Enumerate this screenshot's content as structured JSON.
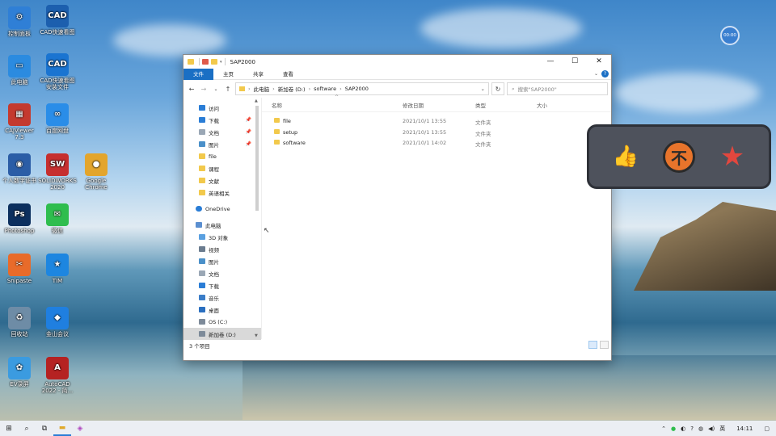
{
  "desktop": {
    "icons": [
      {
        "label": "控制面板",
        "glyph": "⚙",
        "color": "#2f7fd6"
      },
      {
        "label": "CAD快速看图",
        "glyph": "CAD",
        "color": "#1c5fae"
      },
      {
        "label": "此电脑",
        "glyph": "▭",
        "color": "#2b8be0"
      },
      {
        "label": "CAD快速看图 安装文件",
        "glyph": "CAD",
        "color": "#1a74d1"
      },
      {
        "label": "CAJViewer 7.3",
        "glyph": "▦",
        "color": "#c43a2f"
      },
      {
        "label": "百度网盘",
        "glyph": "∞",
        "color": "#2a8de8"
      },
      {
        "label": "个人数字证书",
        "glyph": "◉",
        "color": "#2b5da6"
      },
      {
        "label": "SOLIDWORKS 2020",
        "glyph": "SW",
        "color": "#c62f2f"
      },
      {
        "label": "Google Chrome",
        "glyph": "●",
        "color": "#e3a52d"
      },
      {
        "label": "Photoshop",
        "glyph": "Ps",
        "color": "#0c2f5e"
      },
      {
        "label": "微信",
        "glyph": "✉",
        "color": "#2fbd4e"
      },
      {
        "label": "Snipaste",
        "glyph": "✂",
        "color": "#e86b2a"
      },
      {
        "label": "TIM",
        "glyph": "★",
        "color": "#1d86e0"
      },
      {
        "label": "回收站",
        "glyph": "♻",
        "color": "#6e8ca6"
      },
      {
        "label": "金山会议",
        "glyph": "◆",
        "color": "#1f7fe0"
      },
      {
        "label": "EV录屏",
        "glyph": "✿",
        "color": "#3b9be0"
      },
      {
        "label": "AutoCAD 2022 - 简...",
        "glyph": "A",
        "color": "#b52222"
      }
    ]
  },
  "explorer": {
    "title": "SAP2000",
    "window_controls": {
      "minimize": "—",
      "maximize": "☐",
      "close": "✕"
    },
    "ribbon_tabs": [
      "文件",
      "主页",
      "共享",
      "查看"
    ],
    "address": {
      "crumbs": [
        "此电脑",
        "新加卷 (D:)",
        "software",
        "SAP2000"
      ],
      "search_placeholder": "搜索\"SAP2000\""
    },
    "nav": {
      "quick_access": [
        {
          "label": "访问",
          "icon": "quick-access-icon",
          "pinned": false
        },
        {
          "label": "下载",
          "icon": "download-icon",
          "pinned": true
        },
        {
          "label": "文档",
          "icon": "document-icon",
          "pinned": true
        },
        {
          "label": "图片",
          "icon": "picture-icon",
          "pinned": true
        },
        {
          "label": "file",
          "icon": "folder-icon",
          "pinned": false
        },
        {
          "label": "课程",
          "icon": "folder-icon",
          "pinned": false
        },
        {
          "label": "文献",
          "icon": "folder-icon",
          "pinned": false
        },
        {
          "label": "英语相关",
          "icon": "folder-icon",
          "pinned": false
        }
      ],
      "onedrive": "OneDrive",
      "this_pc": "此电脑",
      "pc_items": [
        {
          "label": "3D 对象",
          "icon": "3d-objects-icon"
        },
        {
          "label": "视频",
          "icon": "video-icon"
        },
        {
          "label": "图片",
          "icon": "picture-icon"
        },
        {
          "label": "文档",
          "icon": "document-icon"
        },
        {
          "label": "下载",
          "icon": "download-icon"
        },
        {
          "label": "音乐",
          "icon": "music-icon"
        },
        {
          "label": "桌面",
          "icon": "desktop-icon"
        },
        {
          "label": "OS (C:)",
          "icon": "drive-icon"
        },
        {
          "label": "新加卷 (D:)",
          "icon": "drive-icon"
        }
      ]
    },
    "columns": {
      "name": "名称",
      "date": "修改日期",
      "type": "类型",
      "size": "大小"
    },
    "files": [
      {
        "name": "file",
        "date": "2021/10/1 13:55",
        "type": "文件夹"
      },
      {
        "name": "setup",
        "date": "2021/10/1 13:55",
        "type": "文件夹"
      },
      {
        "name": "software",
        "date": "2021/10/1 14:02",
        "type": "文件夹"
      }
    ],
    "status": "3 个项目"
  },
  "overlay": {
    "timer": "00:00"
  },
  "taskbar": {
    "clock": "14:11",
    "ime": "英"
  }
}
